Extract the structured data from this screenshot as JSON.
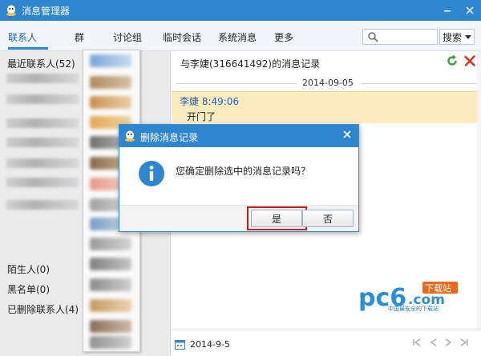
{
  "window": {
    "title": "消息管理器",
    "accent": "#2f86d0"
  },
  "tabs": [
    "联系人",
    "群",
    "讨论组",
    "临时会话",
    "系统消息",
    "更多"
  ],
  "search": {
    "placeholder": "",
    "button": "搜索"
  },
  "left_panel": {
    "recent": "最近联系人(52)",
    "strangers": "陌生人(0)",
    "blacklist": "黑名单(0)",
    "deleted": "已删除联系人(4)"
  },
  "record": {
    "header": "与李婕(316641492)的消息记录",
    "date_separator": "2014-09-05",
    "sender": "李婕 8:49:06",
    "message": "开门了",
    "bottom_date": "2014-9-5"
  },
  "dialog": {
    "title": "删除消息记录",
    "message": "您确定删除选中的消息记录吗？",
    "yes": "是",
    "no": "否",
    "highlight_color": "#cc1d1d"
  },
  "watermark": {
    "brand": "pc6",
    "tld": ".com",
    "badge": "下载站",
    "slogan": "中国最安全的下载站"
  },
  "icons": [
    "qq-icon",
    "minimize-icon",
    "close-icon",
    "search-icon",
    "refresh-icon",
    "delete-icon",
    "info-icon",
    "calendar-icon"
  ]
}
